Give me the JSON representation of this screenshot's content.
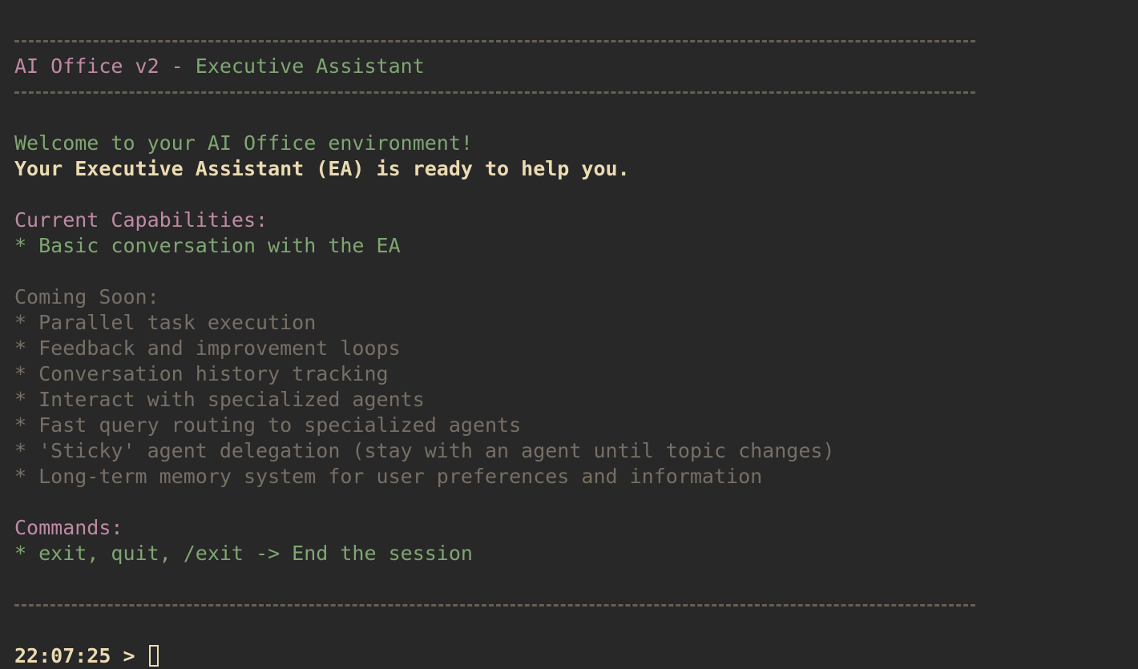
{
  "header": {
    "title_app": "AI Office v2",
    "title_sep": " - ",
    "title_role": "Executive Assistant"
  },
  "welcome": {
    "line1": "Welcome to your AI Office environment!",
    "line2": "Your Executive Assistant (EA) is ready to help you."
  },
  "capabilities": {
    "heading": "Current Capabilities:",
    "items": [
      "* Basic conversation with the EA"
    ]
  },
  "coming_soon": {
    "heading": "Coming Soon:",
    "items": [
      "* Parallel task execution",
      "* Feedback and improvement loops",
      "* Conversation history tracking",
      "* Interact with specialized agents",
      "* Fast query routing to specialized agents",
      "* 'Sticky' agent delegation (stay with an agent until topic changes)",
      "* Long-term memory system for user preferences and information"
    ]
  },
  "commands": {
    "heading": "Commands:",
    "items": [
      "* exit, quit, /exit -> End the session"
    ]
  },
  "prompt": {
    "timestamp": "22:07:25",
    "symbol": ">",
    "input": ""
  }
}
